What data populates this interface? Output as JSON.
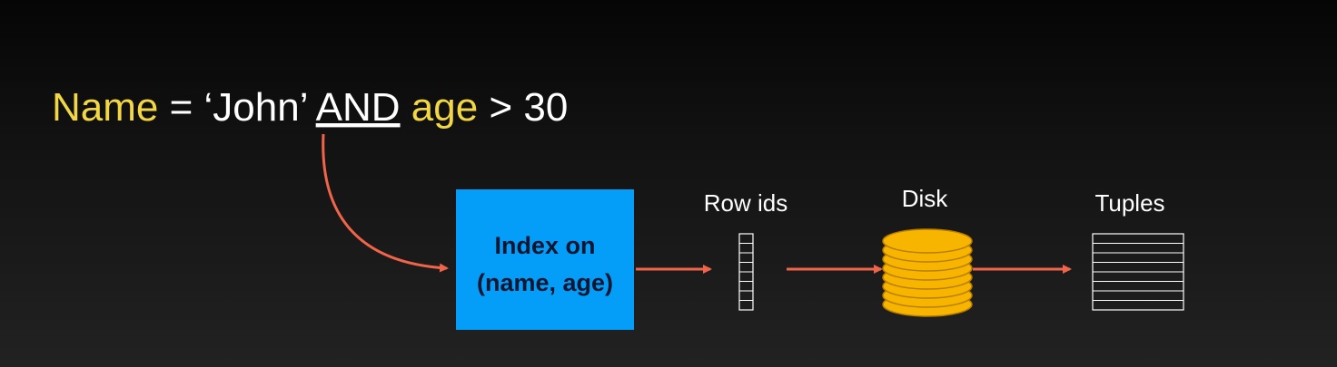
{
  "query": {
    "field1": "Name",
    "op1": " = ‘John’ ",
    "connector": "AND",
    "field2": "age",
    "op2": " > 30"
  },
  "index_box": {
    "line1": "Index on",
    "line2": "(name, age)"
  },
  "labels": {
    "row_ids": "Row ids",
    "disk": "Disk",
    "tuples": "Tuples"
  },
  "colors": {
    "highlight": "#f2d643",
    "text": "#ffffff",
    "arrow": "#f06449",
    "index_fill": "#049ef8",
    "disk_fill": "#f7b500",
    "disk_stroke": "#b97d00"
  }
}
